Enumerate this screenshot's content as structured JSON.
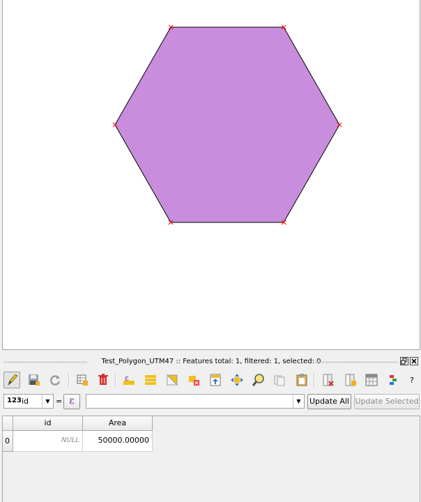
{
  "map": {
    "polygon_fill": "#c88ddc",
    "polygon_stroke": "#000000",
    "vertex_marker_color": "#ff0000"
  },
  "attribute_table": {
    "title": "Test_Polygon_UTM47 :: Features total: 1, filtered: 1, selected: 0",
    "toolbar": {
      "icons": [
        "toggle-editing-icon",
        "save-edits-icon",
        "reload-icon",
        "add-feature-icon",
        "delete-feature-icon",
        "expression-select-icon",
        "select-all-icon",
        "invert-selection-icon",
        "deselect-all-icon",
        "move-selection-top-icon",
        "pan-to-selection-icon",
        "zoom-to-selection-icon",
        "copy-rows-icon",
        "paste-features-icon",
        "delete-field-icon",
        "new-field-icon",
        "field-calculator-icon",
        "conditional-formatting-icon",
        "help-icon"
      ],
      "help_label": "?"
    },
    "field_selector": {
      "type_badge": "123",
      "field": "id"
    },
    "equals_label": "=",
    "expression_symbol": "ε",
    "expression_value": "",
    "update_all_label": "Update All",
    "update_selected_label": "Update Selected",
    "columns": [
      "id",
      "Area"
    ],
    "rows": [
      {
        "row_header": "0",
        "id": "NULL",
        "area": "50000.00000"
      }
    ]
  }
}
